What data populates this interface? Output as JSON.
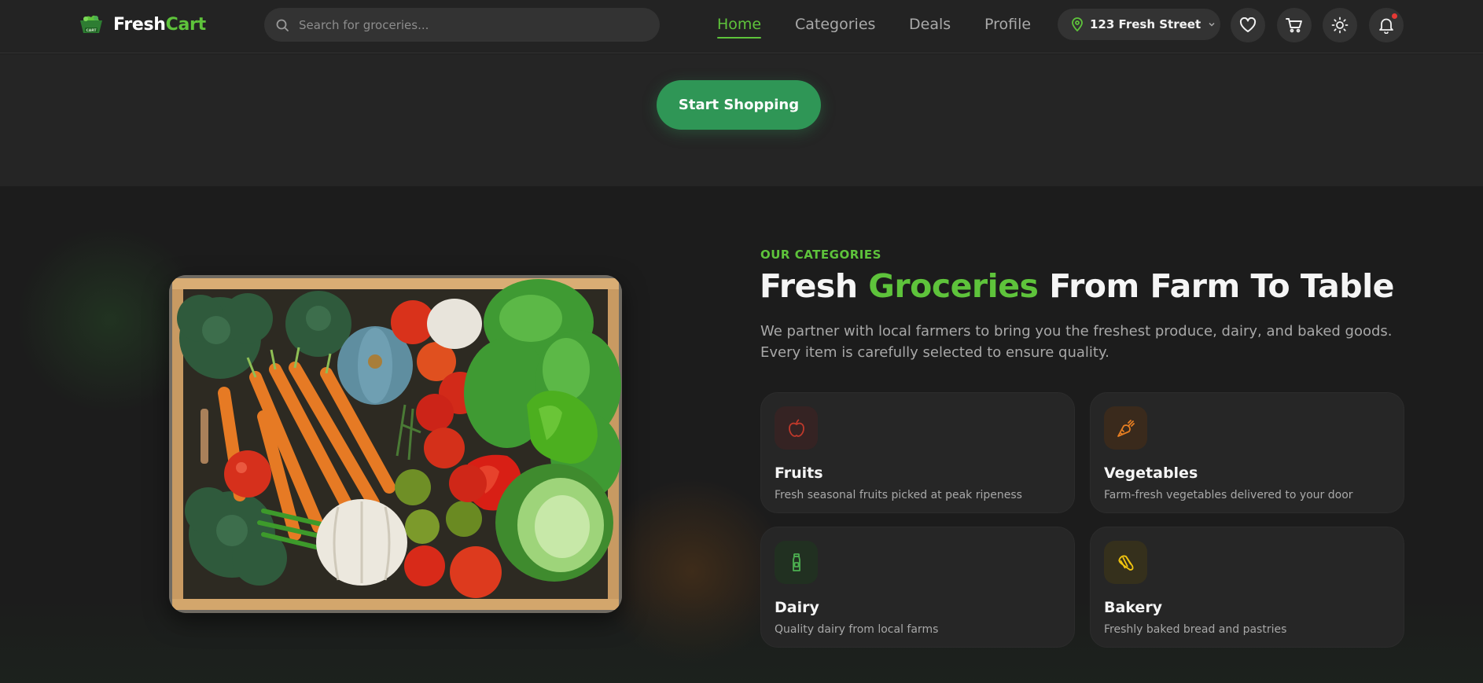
{
  "brand": {
    "name_part1": "Fresh",
    "name_part2": "Cart",
    "logo_caption": "CART"
  },
  "search": {
    "placeholder": "Search for groceries..."
  },
  "nav": {
    "items": [
      {
        "label": "Home",
        "active": true
      },
      {
        "label": "Categories",
        "active": false
      },
      {
        "label": "Deals",
        "active": false
      },
      {
        "label": "Profile",
        "active": false
      }
    ]
  },
  "location": {
    "label": "123 Fresh Street"
  },
  "header_icons": [
    "heart-icon",
    "cart-icon",
    "sun-icon",
    "bell-icon"
  ],
  "hero": {
    "cta_label": "Start Shopping"
  },
  "categories": {
    "kicker": "OUR CATEGORIES",
    "headline_part1": "Fresh ",
    "headline_highlight": "Groceries",
    "headline_part2": " From Farm To Table",
    "description": "We partner with local farmers to bring you the freshest produce, dairy, and baked goods. Every item is carefully selected to ensure quality.",
    "cards": [
      {
        "title": "Fruits",
        "description": "Fresh seasonal fruits picked at peak ripeness",
        "icon": "apple-icon",
        "color": "#c0392b"
      },
      {
        "title": "Vegetables",
        "description": "Farm-fresh vegetables delivered to your door",
        "icon": "carrot-icon",
        "color": "#e67e22"
      },
      {
        "title": "Dairy",
        "description": "Quality dairy from local farms",
        "icon": "milk-bottle-icon",
        "color": "#4caf50"
      },
      {
        "title": "Bakery",
        "description": "Freshly baked bread and pastries",
        "icon": "croissant-icon",
        "color": "#f1c40f"
      }
    ]
  },
  "colors": {
    "accent": "#5ec33b",
    "cta": "#2f9656",
    "background": "#1c1c1c",
    "notification": "#e53935"
  }
}
